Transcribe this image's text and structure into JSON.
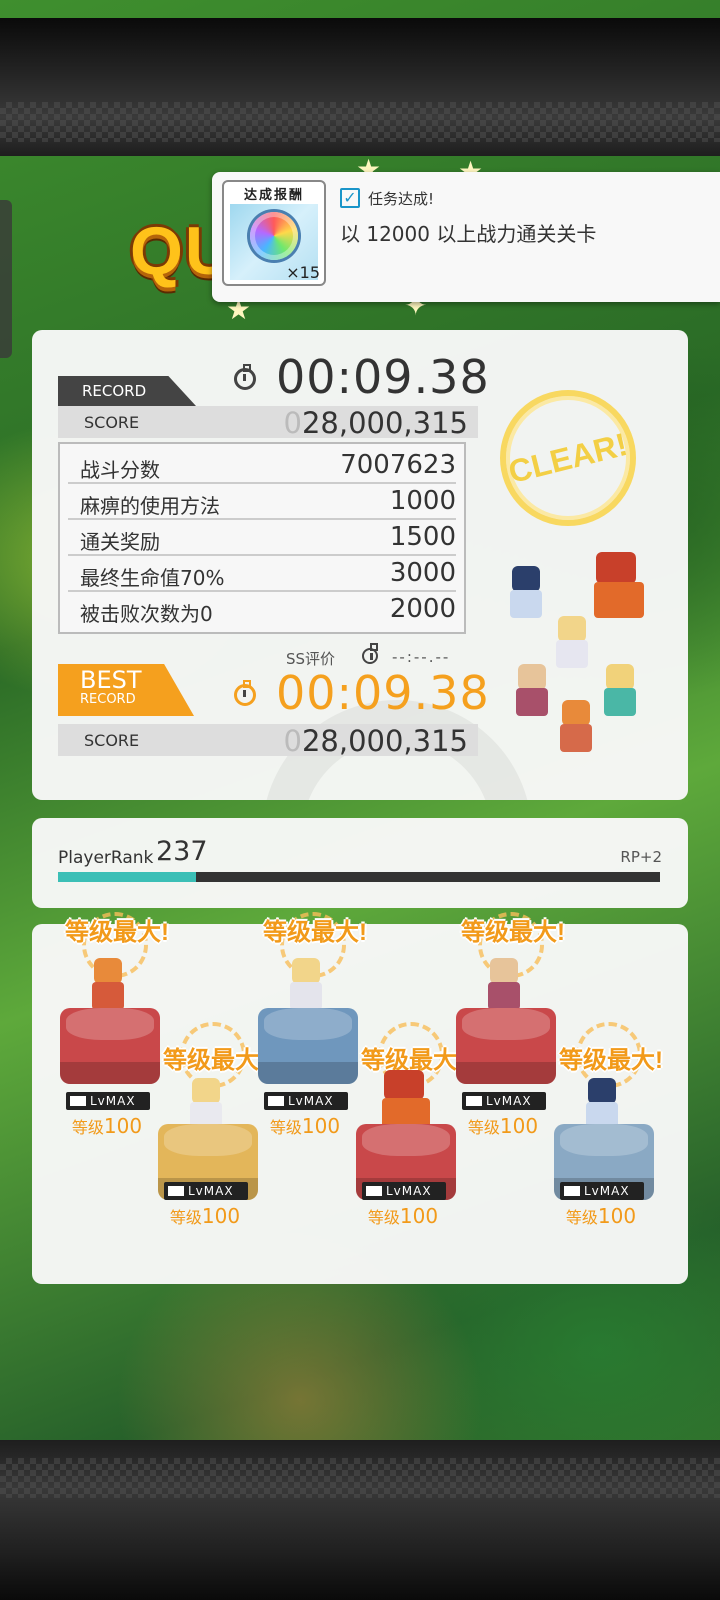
{
  "quest_title": "QU",
  "notification": {
    "reward_label": "达成报酬",
    "reward_icon": "rainbow-orb-icon",
    "reward_count": "×15",
    "status": "任务达成!",
    "description": "以 12000 以上战力通关关卡"
  },
  "record": {
    "tag": "RECORD",
    "time": "00:09.38",
    "score_label": "SCORE",
    "score_prefix": "0",
    "score": "28,000,315"
  },
  "stats": [
    {
      "name": "战斗分数",
      "value": "7007623"
    },
    {
      "name": "麻痹的使用方法",
      "value": "1000"
    },
    {
      "name": "通关奖励",
      "value": "1500"
    },
    {
      "name": "最终生命值70%",
      "value": "3000"
    },
    {
      "name": "被击败次数为0",
      "value": "2000"
    }
  ],
  "ss": {
    "label": "SS评价",
    "time": "--:--.--"
  },
  "best": {
    "tag_line1": "BEST",
    "tag_line2": "RECORD",
    "time": "00:09.38",
    "score_label": "SCORE",
    "score_prefix": "0",
    "score": "28,000,315"
  },
  "clear_stamp": "CLEAR!",
  "player_rank": {
    "label": "PlayerRank",
    "value": "237",
    "rp": "RP+2",
    "progress": 0.23
  },
  "units": [
    {
      "max_label": "等级最大!",
      "lv_badge": "LvMAX",
      "level_prefix": "等级",
      "level": "100",
      "pedestal_color": "#c9484a"
    },
    {
      "max_label": "等级最大!",
      "lv_badge": "LvMAX",
      "level_prefix": "等级",
      "level": "100",
      "pedestal_color": "#e3b65a"
    },
    {
      "max_label": "等级最大!",
      "lv_badge": "LvMAX",
      "level_prefix": "等级",
      "level": "100",
      "pedestal_color": "#6f97bd"
    },
    {
      "max_label": "等级最大!",
      "lv_badge": "LvMAX",
      "level_prefix": "等级",
      "level": "100",
      "pedestal_color": "#c9484a"
    },
    {
      "max_label": "等级最大!",
      "lv_badge": "LvMAX",
      "level_prefix": "等级",
      "level": "100",
      "pedestal_color": "#c9484a"
    },
    {
      "max_label": "等级最大!",
      "lv_badge": "LvMAX",
      "level_prefix": "等级",
      "level": "100",
      "pedestal_color": "#8aa9c4"
    }
  ],
  "colors": {
    "accent": "#f5a01e",
    "teal": "#3bbfb6",
    "title_gold": "#ffc21a"
  }
}
